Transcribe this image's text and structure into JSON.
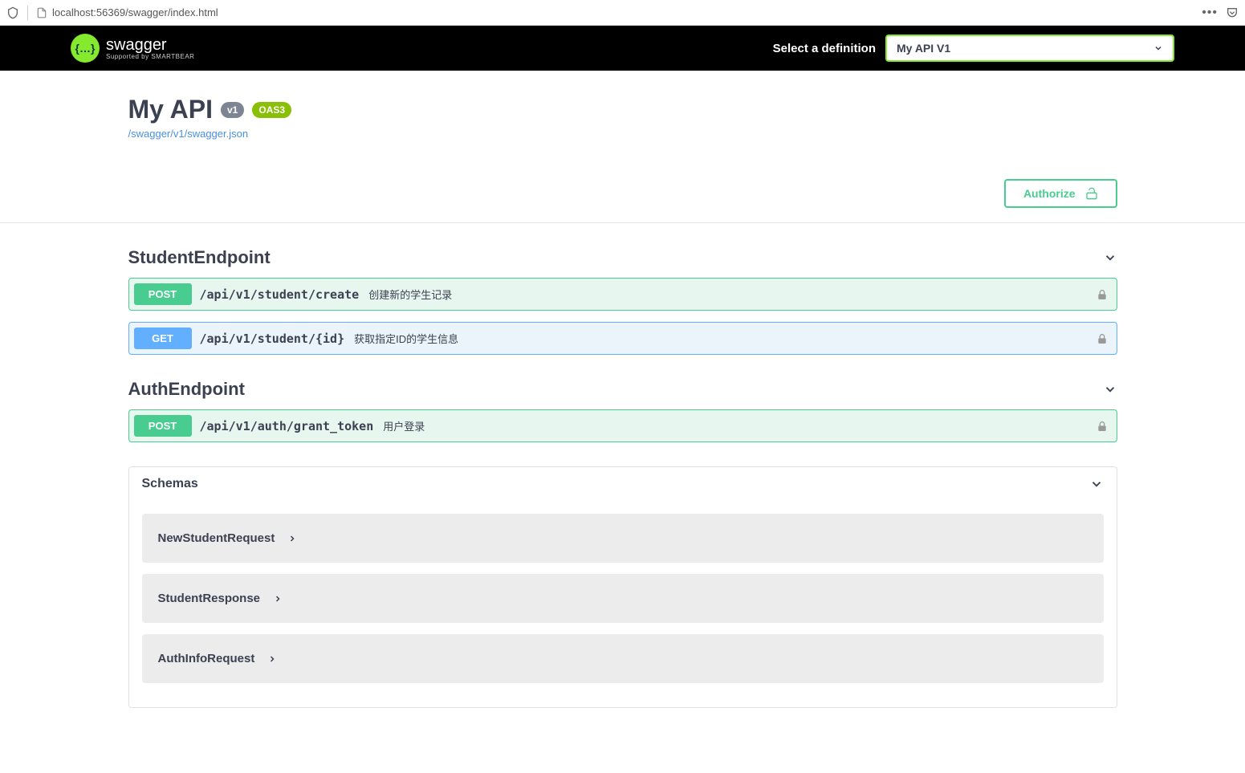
{
  "browser": {
    "url": "localhost:56369/swagger/index.html"
  },
  "topbar": {
    "logo_main": "swagger",
    "logo_sub": "Supported by SMARTBEAR",
    "definition_label": "Select a definition",
    "definition_selected": "My API V1"
  },
  "info": {
    "title": "My API",
    "version": "v1",
    "oas": "OAS3",
    "spec_link": "/swagger/v1/swagger.json"
  },
  "authorize": {
    "label": "Authorize"
  },
  "tags": [
    {
      "name": "StudentEndpoint",
      "operations": [
        {
          "method": "POST",
          "method_class": "post",
          "path": "/api/v1/student/create",
          "summary": "创建新的学生记录"
        },
        {
          "method": "GET",
          "method_class": "get",
          "path": "/api/v1/student/{id}",
          "summary": "获取指定ID的学生信息"
        }
      ]
    },
    {
      "name": "AuthEndpoint",
      "operations": [
        {
          "method": "POST",
          "method_class": "post",
          "path": "/api/v1/auth/grant_token",
          "summary": "用户登录"
        }
      ]
    }
  ],
  "schemas": {
    "title": "Schemas",
    "items": [
      {
        "name": "NewStudentRequest"
      },
      {
        "name": "StudentResponse"
      },
      {
        "name": "AuthInfoRequest"
      }
    ]
  }
}
